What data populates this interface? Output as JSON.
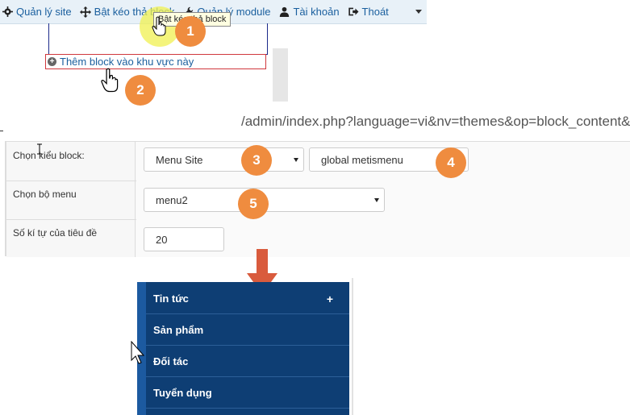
{
  "toolbar": {
    "items": [
      {
        "label": "Quản lý site",
        "icon": "gear-icon"
      },
      {
        "label": "Bật kéo thả block",
        "icon": "move-arrows-icon"
      },
      {
        "label": "Quản lý module",
        "icon": "wrench-icon"
      },
      {
        "label": "Tài khoản",
        "icon": "user-icon"
      },
      {
        "label": "Thoát",
        "icon": "sign-out-icon"
      }
    ],
    "tooltip": "Bật kéo thả block"
  },
  "block_zone": {
    "add_label": "Thêm block vào khu vực này"
  },
  "url": "/admin/index.php?language=vi&nv=themes&op=block_content&se",
  "form": {
    "block_type": {
      "label": "Chọn kiểu block:",
      "module_value": "Menu Site",
      "block_value": "global metismenu"
    },
    "menu": {
      "label": "Chọn bộ menu",
      "value": "menu2"
    },
    "title_length": {
      "label": "Số kí tự của tiêu đề",
      "value": "20"
    }
  },
  "badges": [
    "1",
    "2",
    "3",
    "4",
    "5"
  ],
  "menu": {
    "items": [
      {
        "label": "Tin tức",
        "toggle": "+"
      },
      {
        "label": "Sản phẩm",
        "toggle": ""
      },
      {
        "label": "Đối tác",
        "toggle": ""
      },
      {
        "label": "Tuyển dụng",
        "toggle": ""
      }
    ]
  },
  "colors": {
    "badge": "#ef8c3f",
    "menu_bg": "#0e3e74",
    "menu_strip": "#1c5aa0",
    "arrow": "#d95b3d",
    "link": "#1a5f9e"
  }
}
